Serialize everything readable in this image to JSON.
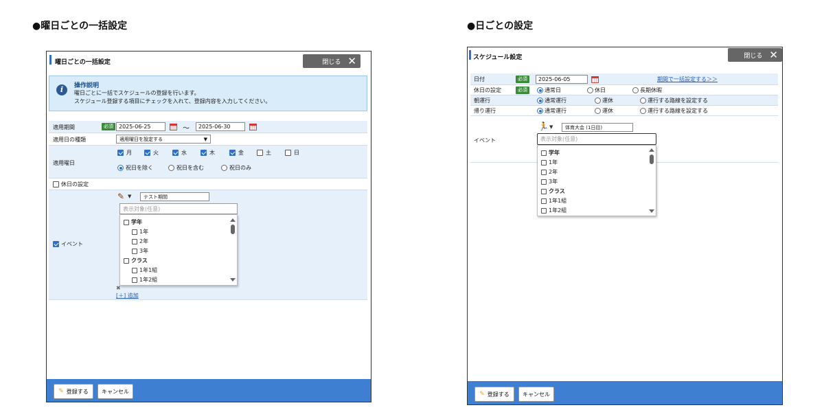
{
  "left": {
    "section_title": "●曜日ごとの一括設定",
    "dialog_title": "曜日ごとの一括設定",
    "close_label": "閉じる",
    "info": {
      "title": "操作説明",
      "line1": "曜日ごとに一括でスケジュールの登録を行います。",
      "line2": "スケジュール登録する項目にチェックを入れて、登録内容を入力してください。"
    },
    "period": {
      "label": "適用期間",
      "required": "必須",
      "start": "2025-06-25",
      "tilde": "～",
      "end": "2025-06-30"
    },
    "day_type": {
      "label": "適用日の種類",
      "selected": "適用曜日を設定する"
    },
    "weekdays": {
      "label": "適用曜日",
      "days": [
        {
          "name": "月",
          "checked": true
        },
        {
          "name": "火",
          "checked": true
        },
        {
          "name": "水",
          "checked": true
        },
        {
          "name": "木",
          "checked": true
        },
        {
          "name": "金",
          "checked": true
        },
        {
          "name": "土",
          "checked": false
        },
        {
          "name": "日",
          "checked": false
        }
      ],
      "holiday_options": [
        "祝日を除く",
        "祝日を含む",
        "祝日のみ"
      ]
    },
    "holiday_setting": "休日の設定",
    "event": {
      "label": "イベント",
      "name": "テスト期間",
      "target_placeholder": "表示対象(任意)",
      "list": [
        "学年",
        "1年",
        "2年",
        "3年",
        "クラス",
        "1年1組",
        "1年2組"
      ],
      "remove": "✖",
      "add": "[＋] 追加"
    },
    "footer": {
      "register": "登録する",
      "cancel": "キャンセル"
    }
  },
  "right": {
    "section_title": "●日ごとの設定",
    "dialog_title": "スケジュール設定",
    "close_label": "閉じる",
    "date": {
      "label": "日付",
      "required": "必須",
      "value": "2025-06-05",
      "link": "期間で一括設定する＞＞"
    },
    "holiday": {
      "label": "休日の設定",
      "required": "必須",
      "options": [
        "通常日",
        "休日",
        "長期休暇"
      ]
    },
    "morning": {
      "label": "朝運行",
      "options": [
        "通常運行",
        "運休",
        "運行する路線を設定する"
      ]
    },
    "return": {
      "label": "帰り運行",
      "options": [
        "通常運行",
        "運休",
        "運行する路線を設定する"
      ]
    },
    "event": {
      "label": "イベント",
      "name": "体育大会 (1日目)",
      "target_placeholder": "表示対象(任意)",
      "list": [
        "学年",
        "1年",
        "2年",
        "3年",
        "クラス",
        "1年1組",
        "1年2組"
      ]
    },
    "footer": {
      "register": "登録する",
      "cancel": "キャンセル"
    }
  },
  "colors": {
    "accent": "#2f6fc7",
    "footer": "#3f7fd2",
    "required": "#3a8a3a",
    "info_bg": "#d9ecfa"
  }
}
